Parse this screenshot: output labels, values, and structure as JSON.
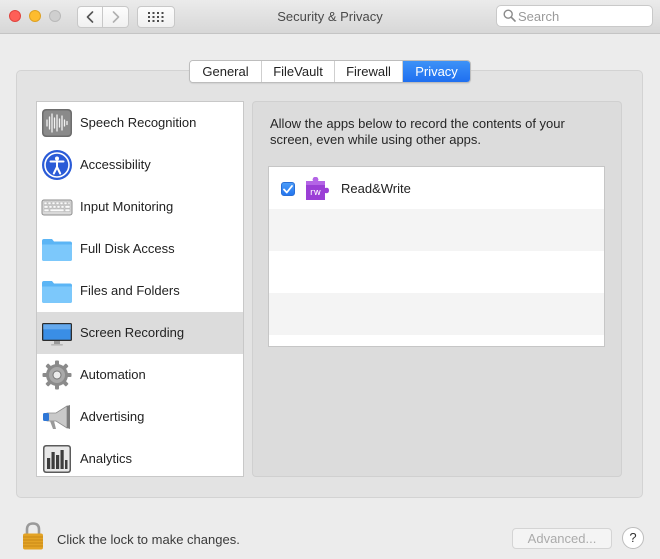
{
  "window": {
    "title": "Security & Privacy",
    "search_placeholder": "Search"
  },
  "tabs": [
    {
      "label": "General",
      "active": false
    },
    {
      "label": "FileVault",
      "active": false
    },
    {
      "label": "Firewall",
      "active": false
    },
    {
      "label": "Privacy",
      "active": true
    }
  ],
  "sidebar": {
    "items": [
      {
        "label": "Speech Recognition",
        "icon": "speech-waveform-icon"
      },
      {
        "label": "Accessibility",
        "icon": "accessibility-icon"
      },
      {
        "label": "Input Monitoring",
        "icon": "keyboard-icon"
      },
      {
        "label": "Full Disk Access",
        "icon": "folder-icon"
      },
      {
        "label": "Files and Folders",
        "icon": "folder-icon"
      },
      {
        "label": "Screen Recording",
        "icon": "display-icon",
        "selected": true
      },
      {
        "label": "Automation",
        "icon": "gear-icon"
      },
      {
        "label": "Advertising",
        "icon": "megaphone-icon"
      },
      {
        "label": "Analytics",
        "icon": "analytics-chart-icon"
      }
    ]
  },
  "content": {
    "description": "Allow the apps below to record the contents of your screen, even while using other apps.",
    "apps": [
      {
        "name": "Read&Write",
        "checked": true,
        "icon": "readwrite-puzzle-icon",
        "icon_text": "rw"
      }
    ]
  },
  "footer": {
    "lock_text": "Click the lock to make changes.",
    "advanced_label": "Advanced...",
    "help_label": "?"
  },
  "colors": {
    "accent": "#2476f0",
    "selected_row": "#dcdcdc",
    "app_icon": "#9b3fd6"
  }
}
